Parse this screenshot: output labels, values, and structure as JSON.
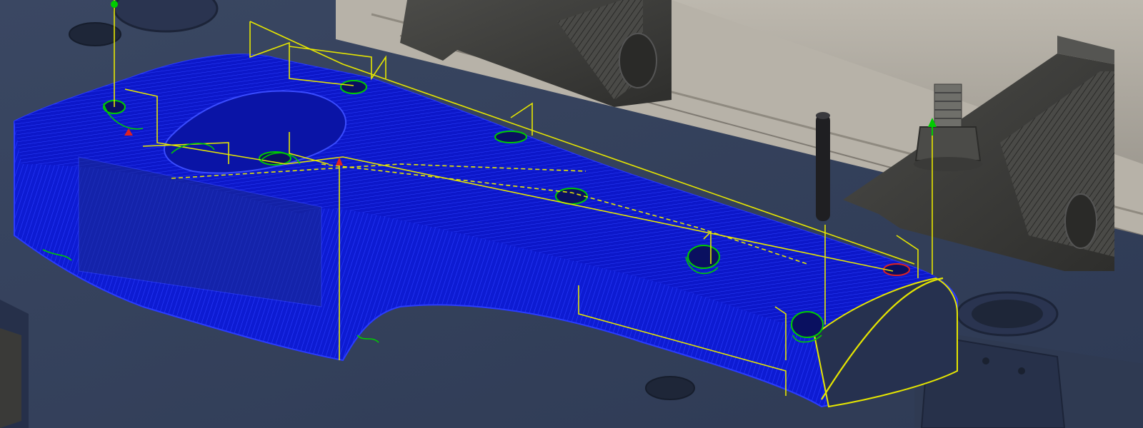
{
  "viewport": {
    "kind": "cam-toolpath-3d-view",
    "colors": {
      "background": "#e6e6e6",
      "fixture_plate": "#34405a",
      "fixture_plate_edge": "#26304a",
      "rail": "#a8a39a",
      "clamp": "#3e3e3c",
      "part": "#0a18d8",
      "toolpath_cut": "#1a28ff",
      "toolpath_link": "#e6e600",
      "plunge_marker": "#00cc00",
      "retract_marker": "#dd2222",
      "hole": "#1e2638",
      "pin": "#1f1f22"
    },
    "icons": [
      "clamp-icon",
      "bolt-icon",
      "locating-pin-icon",
      "start-point-icon",
      "end-point-icon"
    ]
  }
}
